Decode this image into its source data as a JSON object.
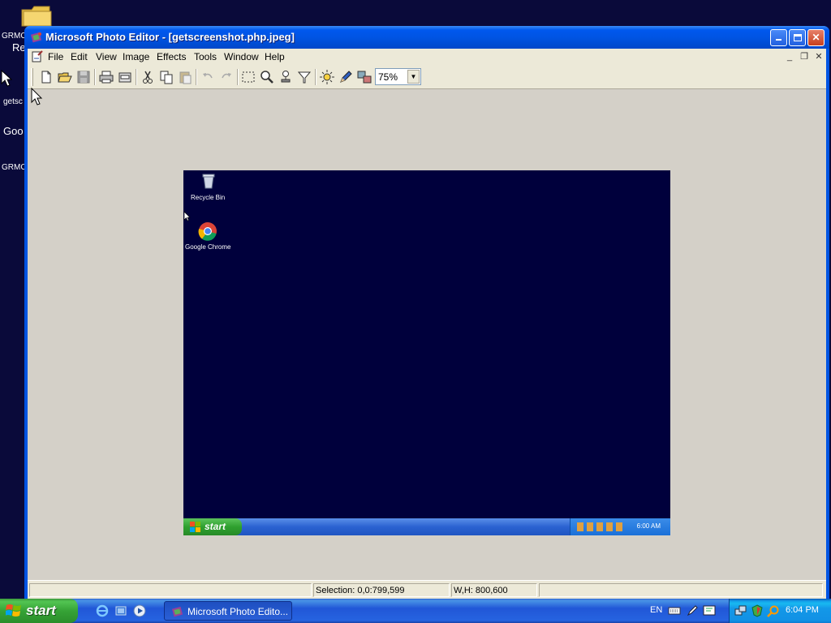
{
  "desktop": {
    "labels": [
      "GRMC",
      "Re",
      "getsc",
      "Goo",
      "GRMC"
    ]
  },
  "window": {
    "title": "Microsoft Photo Editor - [getscreenshot.php.jpeg]"
  },
  "menu": {
    "items": [
      "File",
      "Edit",
      "View",
      "Image",
      "Effects",
      "Tools",
      "Window",
      "Help"
    ]
  },
  "toolbar": {
    "zoom_value": "75%",
    "icons": [
      "new-icon",
      "open-icon",
      "save-icon",
      "print-icon",
      "scan-icon",
      "cut-icon",
      "copy-icon",
      "paste-icon",
      "undo-icon",
      "redo-icon",
      "select-icon",
      "zoom-icon",
      "stamp-icon",
      "funnel-icon",
      "brightness-icon",
      "pen-icon",
      "convert-icon"
    ]
  },
  "image_content": {
    "icons": [
      {
        "label": "Recycle Bin"
      },
      {
        "label": "Google Chrome"
      }
    ],
    "start_label": "start",
    "clock": "6:00 AM"
  },
  "statusbar": {
    "selection": "Selection: 0,0:799,599",
    "size": "W,H: 800,600"
  },
  "taskbar": {
    "start_label": "start",
    "task_label": "Microsoft Photo Edito...",
    "language": "EN",
    "clock": "6:04 PM"
  },
  "colors": {
    "title_blue": "#0054e3",
    "start_green": "#36a336",
    "desktop_navy": "#00003c"
  }
}
